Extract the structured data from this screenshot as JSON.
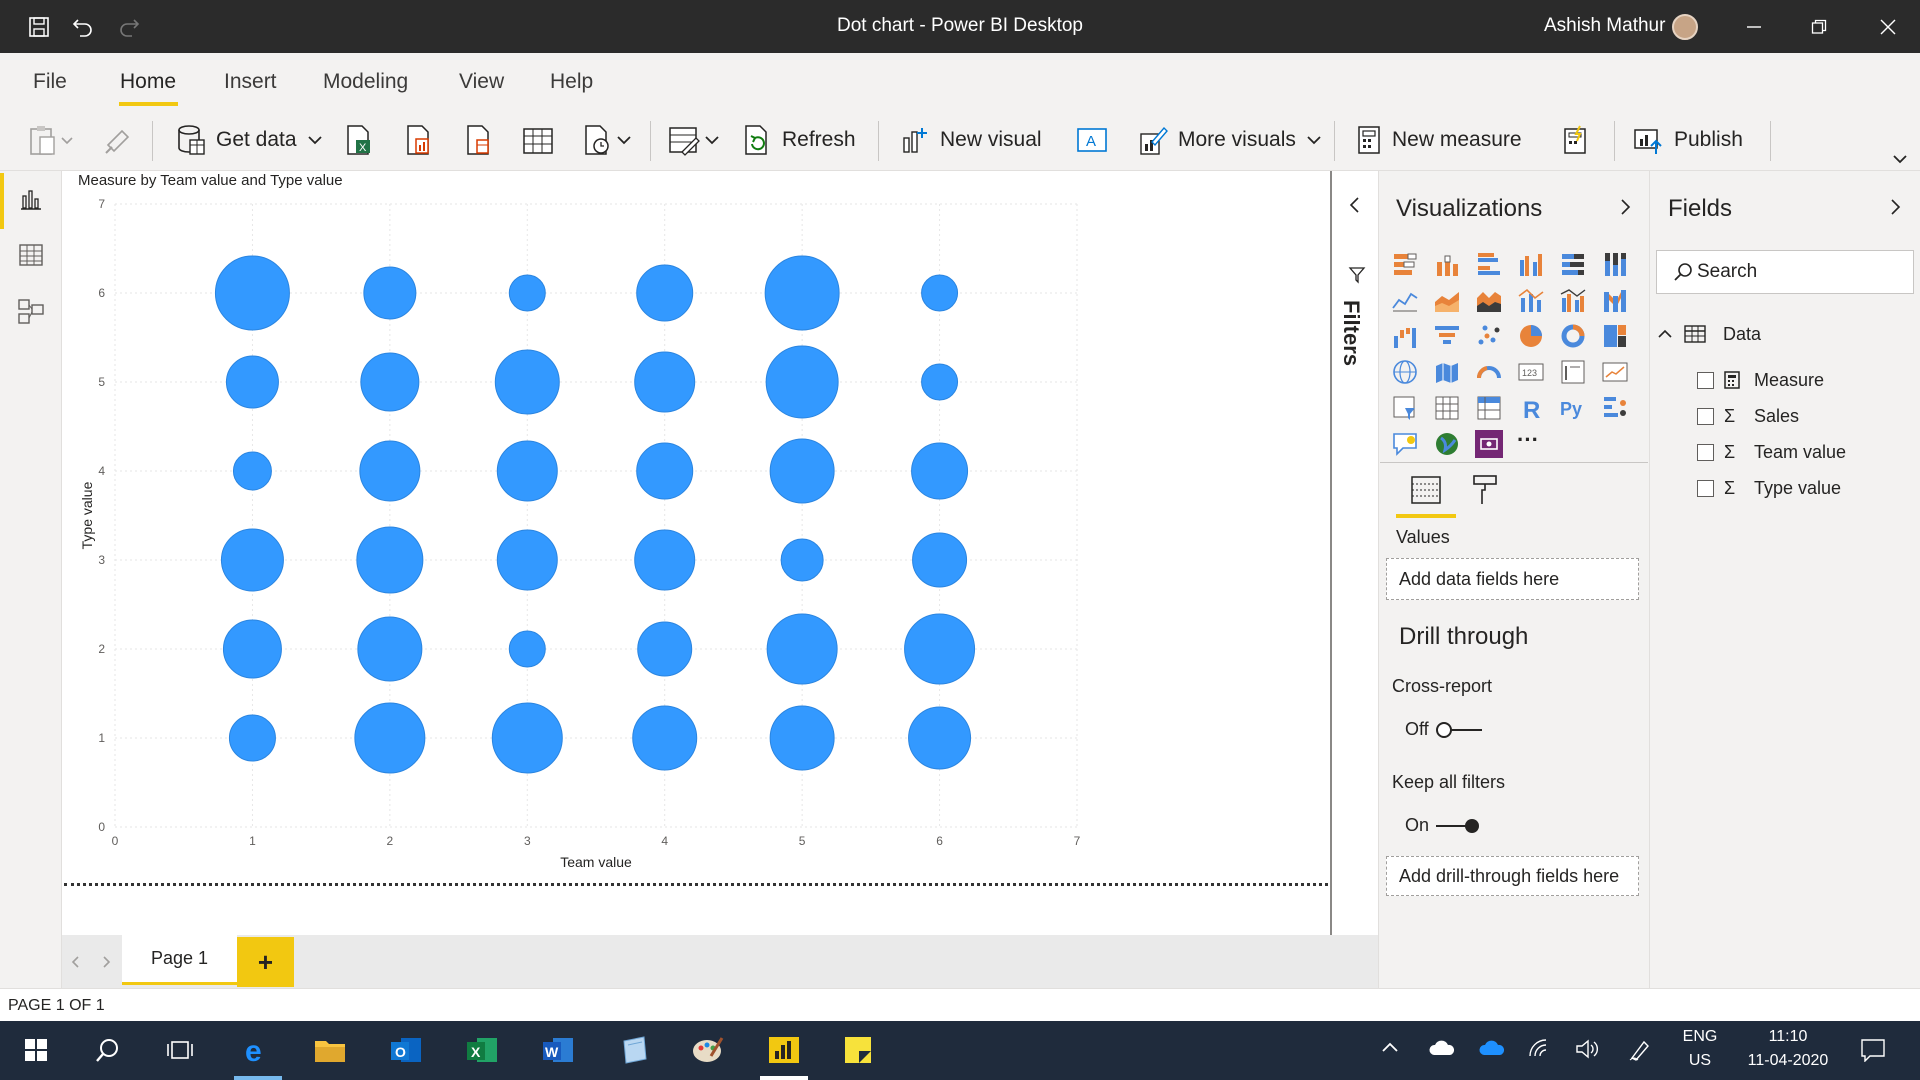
{
  "window": {
    "title": "Dot chart - Power BI Desktop",
    "user": "Ashish Mathur"
  },
  "menu": {
    "items": [
      "File",
      "Home",
      "Insert",
      "Modeling",
      "View",
      "Help"
    ],
    "active": "Home"
  },
  "ribbon": {
    "get_data": "Get data",
    "refresh": "Refresh",
    "new_visual": "New visual",
    "more_visuals": "More visuals",
    "new_measure": "New measure",
    "publish": "Publish"
  },
  "chart_data": {
    "type": "scatter",
    "title": "Measure by Team value and Type value",
    "xlabel": "Team value",
    "ylabel": "Type value",
    "xlim": [
      0,
      7
    ],
    "ylim": [
      0,
      7
    ],
    "xticks": [
      0,
      1,
      2,
      3,
      4,
      5,
      6,
      7
    ],
    "yticks": [
      0,
      1,
      2,
      3,
      4,
      5,
      6,
      7
    ],
    "grid": true,
    "color": "#3399ff",
    "points": [
      {
        "x": 1,
        "y": 6,
        "size": 37
      },
      {
        "x": 2,
        "y": 6,
        "size": 26
      },
      {
        "x": 3,
        "y": 6,
        "size": 18
      },
      {
        "x": 4,
        "y": 6,
        "size": 28
      },
      {
        "x": 5,
        "y": 6,
        "size": 37
      },
      {
        "x": 6,
        "y": 6,
        "size": 18
      },
      {
        "x": 1,
        "y": 5,
        "size": 26
      },
      {
        "x": 2,
        "y": 5,
        "size": 29
      },
      {
        "x": 3,
        "y": 5,
        "size": 32
      },
      {
        "x": 4,
        "y": 5,
        "size": 30
      },
      {
        "x": 5,
        "y": 5,
        "size": 36
      },
      {
        "x": 6,
        "y": 5,
        "size": 18
      },
      {
        "x": 1,
        "y": 4,
        "size": 19
      },
      {
        "x": 2,
        "y": 4,
        "size": 30
      },
      {
        "x": 3,
        "y": 4,
        "size": 30
      },
      {
        "x": 4,
        "y": 4,
        "size": 28
      },
      {
        "x": 5,
        "y": 4,
        "size": 32
      },
      {
        "x": 6,
        "y": 4,
        "size": 28
      },
      {
        "x": 1,
        "y": 3,
        "size": 31
      },
      {
        "x": 2,
        "y": 3,
        "size": 33
      },
      {
        "x": 3,
        "y": 3,
        "size": 30
      },
      {
        "x": 4,
        "y": 3,
        "size": 30
      },
      {
        "x": 5,
        "y": 3,
        "size": 21
      },
      {
        "x": 6,
        "y": 3,
        "size": 27
      },
      {
        "x": 1,
        "y": 2,
        "size": 29
      },
      {
        "x": 2,
        "y": 2,
        "size": 32
      },
      {
        "x": 3,
        "y": 2,
        "size": 18
      },
      {
        "x": 4,
        "y": 2,
        "size": 27
      },
      {
        "x": 5,
        "y": 2,
        "size": 35
      },
      {
        "x": 6,
        "y": 2,
        "size": 35
      },
      {
        "x": 1,
        "y": 1,
        "size": 23
      },
      {
        "x": 2,
        "y": 1,
        "size": 35
      },
      {
        "x": 3,
        "y": 1,
        "size": 35
      },
      {
        "x": 4,
        "y": 1,
        "size": 32
      },
      {
        "x": 5,
        "y": 1,
        "size": 32
      },
      {
        "x": 6,
        "y": 1,
        "size": 31
      }
    ]
  },
  "pages": {
    "tab": "Page 1",
    "add": "+",
    "status": "PAGE 1 OF 1"
  },
  "filters": {
    "label": "Filters"
  },
  "visualizations": {
    "title": "Visualizations",
    "values_label": "Values",
    "values_placeholder": "Add data fields here",
    "drill_title": "Drill through",
    "cross_report_label": "Cross-report",
    "cross_report_state": "Off",
    "keep_filters_label": "Keep all filters",
    "keep_filters_state": "On",
    "drill_placeholder": "Add drill-through fields here",
    "more": "···"
  },
  "fields": {
    "title": "Fields",
    "search_placeholder": "Search",
    "table": "Data",
    "items": [
      {
        "name": "Measure",
        "icon": "calculator-icon"
      },
      {
        "name": "Sales",
        "icon": "sigma-icon"
      },
      {
        "name": "Team value",
        "icon": "sigma-icon"
      },
      {
        "name": "Type value",
        "icon": "sigma-icon"
      }
    ]
  },
  "taskbar": {
    "lang1": "ENG",
    "lang2": "US",
    "time": "11:10",
    "date": "11-04-2020"
  }
}
